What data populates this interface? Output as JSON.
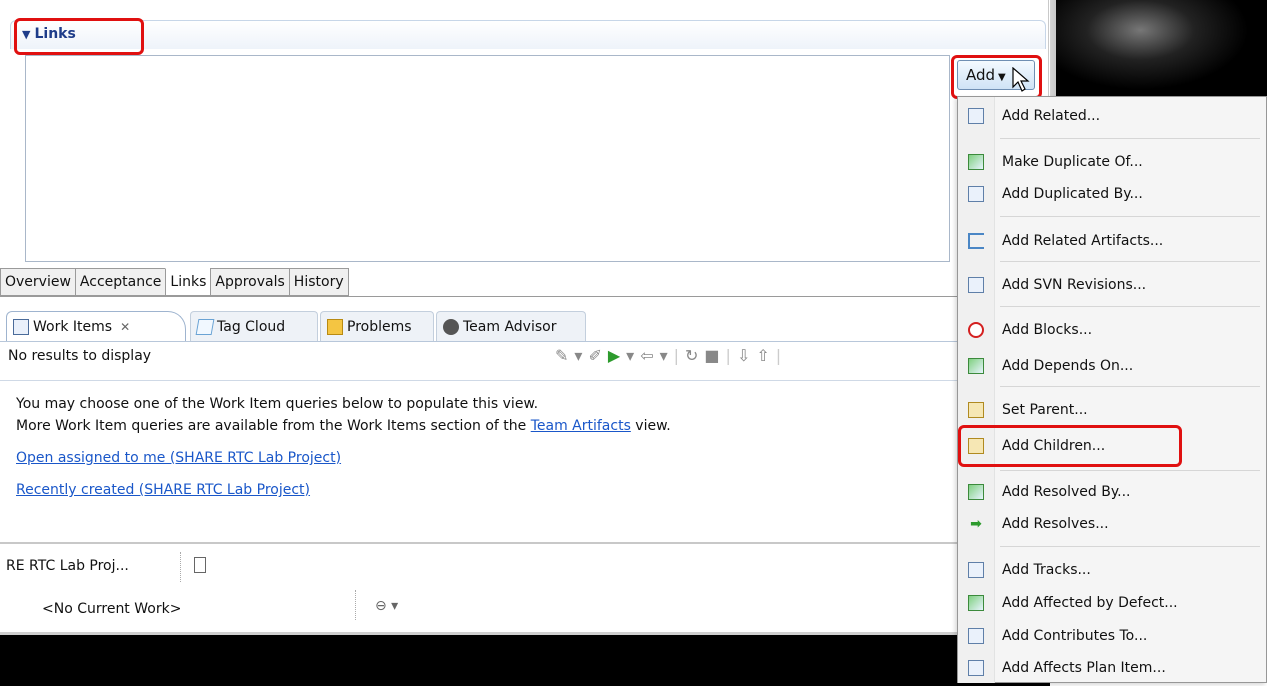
{
  "section": {
    "title": "Links"
  },
  "add_button": {
    "label": "Add"
  },
  "editor_tabs": [
    "Overview",
    "Acceptance",
    "Links",
    "Approvals",
    "History"
  ],
  "view_tabs": [
    {
      "label": "Work Items",
      "icon": "work-items-icon",
      "active": true
    },
    {
      "label": "Tag Cloud",
      "icon": "tag-cloud-icon",
      "active": false
    },
    {
      "label": "Problems",
      "icon": "problems-icon",
      "active": false
    },
    {
      "label": "Team Advisor",
      "icon": "team-advisor-icon",
      "active": false
    }
  ],
  "work_items": {
    "status": "No results to display",
    "message_line1": "You may choose one of the Work Item queries below to populate this view.",
    "message_line2_prefix": "More Work Item queries are available from the Work Items section of the ",
    "message_link": "Team Artifacts",
    "message_line2_suffix": " view.",
    "queries": [
      "Open assigned to me (SHARE RTC Lab Project)",
      "Recently created (SHARE RTC Lab Project)"
    ]
  },
  "team_central": {
    "project_label": "RE RTC Lab Proj...",
    "current_work": "<No Current Work>"
  },
  "menu": {
    "items": [
      {
        "label": "Add Related...",
        "icon": "related-icon"
      },
      {
        "label": "Make Duplicate Of...",
        "icon": "duplicate-of-icon"
      },
      {
        "label": "Add Duplicated By...",
        "icon": "duplicated-by-icon"
      },
      {
        "label": "Add Related Artifacts...",
        "icon": "related-artifacts-icon"
      },
      {
        "label": "Add SVN Revisions...",
        "icon": "svn-revisions-icon"
      },
      {
        "label": "Add Blocks...",
        "icon": "blocks-icon"
      },
      {
        "label": "Add Depends On...",
        "icon": "depends-on-icon"
      },
      {
        "label": "Set Parent...",
        "icon": "parent-icon"
      },
      {
        "label": "Add Children...",
        "icon": "children-icon",
        "highlighted": true
      },
      {
        "label": "Add Resolved By...",
        "icon": "resolved-by-icon"
      },
      {
        "label": "Add Resolves...",
        "icon": "resolves-icon"
      },
      {
        "label": "Add Tracks...",
        "icon": "tracks-icon"
      },
      {
        "label": "Add Affected by Defect...",
        "icon": "affected-by-defect-icon"
      },
      {
        "label": "Add Contributes To...",
        "icon": "contributes-to-icon"
      },
      {
        "label": "Add Affects Plan Item...",
        "icon": "affects-plan-item-icon"
      }
    ]
  },
  "colors": {
    "highlight_box": "#e01010",
    "link": "#1a57c9",
    "section_title": "#1f3d8a"
  }
}
